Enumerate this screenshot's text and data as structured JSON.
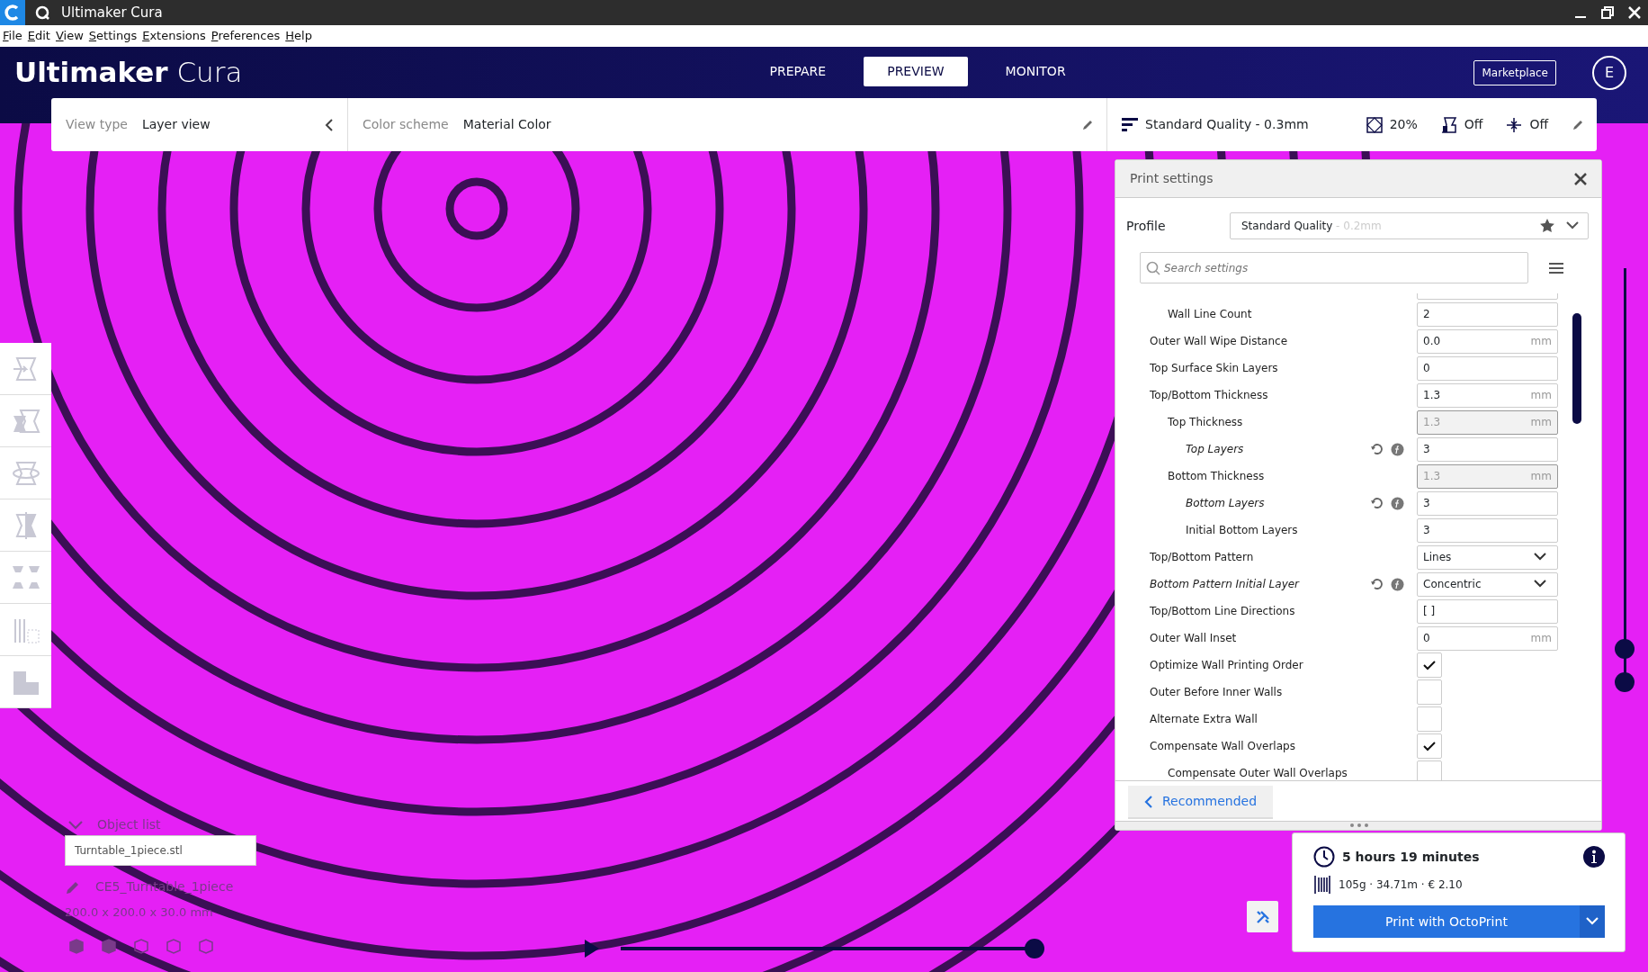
{
  "window": {
    "title": "Ultimaker Cura"
  },
  "menu": [
    {
      "label": "File"
    },
    {
      "label": "Edit"
    },
    {
      "label": "View"
    },
    {
      "label": "Settings"
    },
    {
      "label": "Extensions"
    },
    {
      "label": "Preferences"
    },
    {
      "label": "Help"
    }
  ],
  "header": {
    "logo_bold": "Ultimaker",
    "logo_light": "Cura",
    "stages": [
      {
        "label": "PREPARE",
        "selected": false
      },
      {
        "label": "PREVIEW",
        "selected": true
      },
      {
        "label": "MONITOR",
        "selected": false
      }
    ],
    "marketplace": "Marketplace",
    "account_initial": "E"
  },
  "view_bar": {
    "view_type_label": "View type",
    "view_type": "Layer view",
    "color_scheme_label": "Color scheme",
    "color_scheme": "Material Color",
    "quality": "Standard Quality - 0.3mm",
    "infill": "20%",
    "support": "Off",
    "adhesion": "Off"
  },
  "print_settings": {
    "title": "Print settings",
    "profile_label": "Profile",
    "profile": "Standard Quality",
    "profile_detail": "- 0.2mm",
    "search_placeholder": "Search settings",
    "settings": [
      {
        "kind": "clipped",
        "children": [
          {
            "kind": "text",
            "label": "Wall Line Count",
            "value": "2"
          }
        ]
      },
      {
        "kind": "text",
        "label": "Outer Wall Wipe Distance",
        "value": "0.0",
        "unit": "mm"
      },
      {
        "kind": "text",
        "label": "Top Surface Skin Layers",
        "value": "0"
      },
      {
        "kind": "text",
        "label": "Top/Bottom Thickness",
        "value": "1.3",
        "unit": "mm",
        "children": [
          {
            "kind": "text",
            "label": "Top Thickness",
            "value": "1.3",
            "unit": "mm",
            "disabled": true,
            "children": [
              {
                "kind": "text",
                "label": "Top Layers",
                "value": "3",
                "overridden": true
              }
            ]
          },
          {
            "kind": "text",
            "label": "Bottom Thickness",
            "value": "1.3",
            "unit": "mm",
            "disabled": true,
            "children": [
              {
                "kind": "text",
                "label": "Bottom Layers",
                "value": "3",
                "overridden": true
              },
              {
                "kind": "text",
                "label": "Initial Bottom Layers",
                "value": "3"
              }
            ]
          }
        ]
      },
      {
        "kind": "select",
        "label": "Top/Bottom Pattern",
        "value": "Lines"
      },
      {
        "kind": "select",
        "label": "Bottom Pattern Initial Layer",
        "value": "Concentric",
        "overridden": true
      },
      {
        "kind": "text",
        "label": "Top/Bottom Line Directions",
        "value": "[ ]"
      },
      {
        "kind": "text",
        "label": "Outer Wall Inset",
        "value": "0",
        "unit": "mm"
      },
      {
        "kind": "checkbox",
        "label": "Optimize Wall Printing Order",
        "checked": true
      },
      {
        "kind": "checkbox",
        "label": "Outer Before Inner Walls",
        "checked": false
      },
      {
        "kind": "checkbox",
        "label": "Alternate Extra Wall",
        "checked": false
      },
      {
        "kind": "checkbox",
        "label": "Compensate Wall Overlaps",
        "checked": true,
        "children": [
          {
            "kind": "checkbox",
            "label": "Compensate Outer Wall Overlaps",
            "checked": false
          }
        ]
      }
    ],
    "footer_button": "Recommended"
  },
  "object_list": {
    "title": "Object list",
    "objects": [
      {
        "name": "Turntable_1piece.stl"
      }
    ],
    "job_name": "CE5_Turntable_1piece",
    "dimensions": "200.0 x 200.0 x 30.0 mm"
  },
  "layer_slider": {
    "upper": {
      "level": 0.08
    },
    "lower": {
      "level": 0
    }
  },
  "path_slider": {
    "level": 1
  },
  "print_info": {
    "time": "5 hours 19 minutes",
    "material": "105g · 34.71m · € 2.10",
    "print_button": "Print with OctoPrint"
  }
}
